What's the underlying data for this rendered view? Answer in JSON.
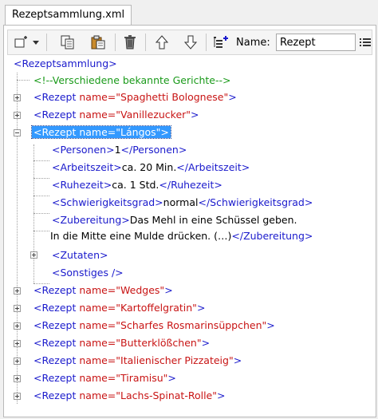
{
  "tab": {
    "title": "Rezeptsammlung.xml"
  },
  "toolbar": {
    "name_label": "Name:",
    "name_value": "Rezept",
    "icons": [
      "new-node-icon",
      "dropdown-caret-icon",
      "copy-icon",
      "paste-icon",
      "delete-icon",
      "move-up-icon",
      "move-down-icon",
      "add-child-icon",
      "list-icon"
    ]
  },
  "tree": {
    "root": "<Rezeptsammlung>",
    "comment": "<!--Verschiedene bekannte Gerichte-->",
    "recipes_before": [
      {
        "open": "<Rezept ",
        "attr": "name=",
        "value": "\"Spaghetti Bolognese\"",
        "close": ">"
      },
      {
        "open": "<Rezept ",
        "attr": "name=",
        "value": "\"Vanillezucker\"",
        "close": ">"
      }
    ],
    "selected": {
      "text": "<Rezept name=\"Lángos\">"
    },
    "children": {
      "personen": {
        "open": "<Personen>",
        "text": "1",
        "close": "</Personen>"
      },
      "arbeitszeit": {
        "open": "<Arbeitszeit>",
        "text": "ca. 20 Min.",
        "close": "</Arbeitszeit>"
      },
      "ruhezeit": {
        "open": "<Ruhezeit>",
        "text": "ca. 1 Std.",
        "close": "</Ruhezeit>"
      },
      "schwierigkeit": {
        "open": "<Schwierigkeitsgrad>",
        "text": "normal",
        "close": "</Schwierigkeitsgrad>"
      },
      "zubereitung": {
        "open": "<Zubereitung>",
        "text1": "Das Mehl in eine Schüssel geben.",
        "text2": "In die Mitte eine Mulde drücken. (…)",
        "close": "</Zubereitung>"
      },
      "zutaten": "<Zutaten>",
      "sonstiges": "<Sonstiges />"
    },
    "recipes_after": [
      {
        "open": "<Rezept ",
        "attr": "name=",
        "value": "\"Wedges\"",
        "close": ">"
      },
      {
        "open": "<Rezept ",
        "attr": "name=",
        "value": "\"Kartoffelgratin\"",
        "close": ">"
      },
      {
        "open": "<Rezept ",
        "attr": "name=",
        "value": "\"Scharfes Rosmarinsüppchen\"",
        "close": ">"
      },
      {
        "open": "<Rezept ",
        "attr": "name=",
        "value": "\"Butterklößchen\"",
        "close": ">"
      },
      {
        "open": "<Rezept ",
        "attr": "name=",
        "value": "\"Italienischer Pizzateig\"",
        "close": ">"
      },
      {
        "open": "<Rezept ",
        "attr": "name=",
        "value": "\"Tiramisu\"",
        "close": ">"
      },
      {
        "open": "<Rezept ",
        "attr": "name=",
        "value": "\"Lachs-Spinat-Rolle\"",
        "close": ">"
      }
    ]
  }
}
